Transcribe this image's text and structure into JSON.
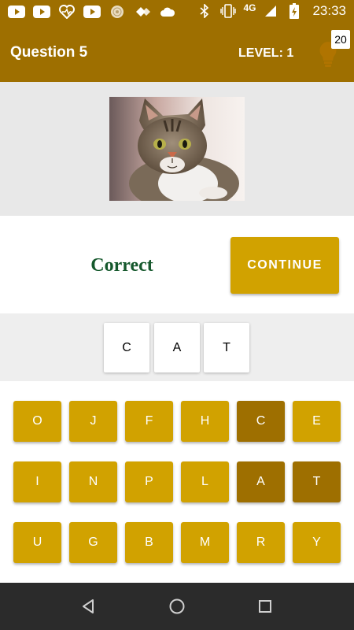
{
  "status_bar": {
    "time": "23:33",
    "network": "4G",
    "left_icons": [
      "youtube-icon",
      "youtube-icon",
      "heart-monitor-icon",
      "youtube-icon",
      "circle-pattern-icon",
      "diamond-arrows-icon",
      "cloud-icon"
    ],
    "right_icons": [
      "bluetooth-icon",
      "vibrate-icon",
      "signal-icon",
      "battery-charging-icon"
    ]
  },
  "header": {
    "title": "Question 5",
    "level": "LEVEL: 1",
    "hint_count": "20",
    "accent": "#9e6f00"
  },
  "question": {
    "image": "cat-photo"
  },
  "result": {
    "text": "Correct",
    "text_color": "#15582c",
    "continue_label": "CONTINUE",
    "button_color": "#d1a200"
  },
  "answer": {
    "letters": [
      "C",
      "A",
      "T"
    ]
  },
  "keyboard": {
    "rows": [
      [
        {
          "letter": "O",
          "used": false
        },
        {
          "letter": "J",
          "used": false
        },
        {
          "letter": "F",
          "used": false
        },
        {
          "letter": "H",
          "used": false
        },
        {
          "letter": "C",
          "used": true
        },
        {
          "letter": "E",
          "used": false
        }
      ],
      [
        {
          "letter": "I",
          "used": false
        },
        {
          "letter": "N",
          "used": false
        },
        {
          "letter": "P",
          "used": false
        },
        {
          "letter": "L",
          "used": false
        },
        {
          "letter": "A",
          "used": true
        },
        {
          "letter": "T",
          "used": true
        }
      ],
      [
        {
          "letter": "U",
          "used": false
        },
        {
          "letter": "G",
          "used": false
        },
        {
          "letter": "B",
          "used": false
        },
        {
          "letter": "M",
          "used": false
        },
        {
          "letter": "R",
          "used": false
        },
        {
          "letter": "Y",
          "used": false
        }
      ]
    ]
  },
  "nav_bar": {
    "buttons": [
      "back-icon",
      "home-icon",
      "recents-icon"
    ]
  }
}
